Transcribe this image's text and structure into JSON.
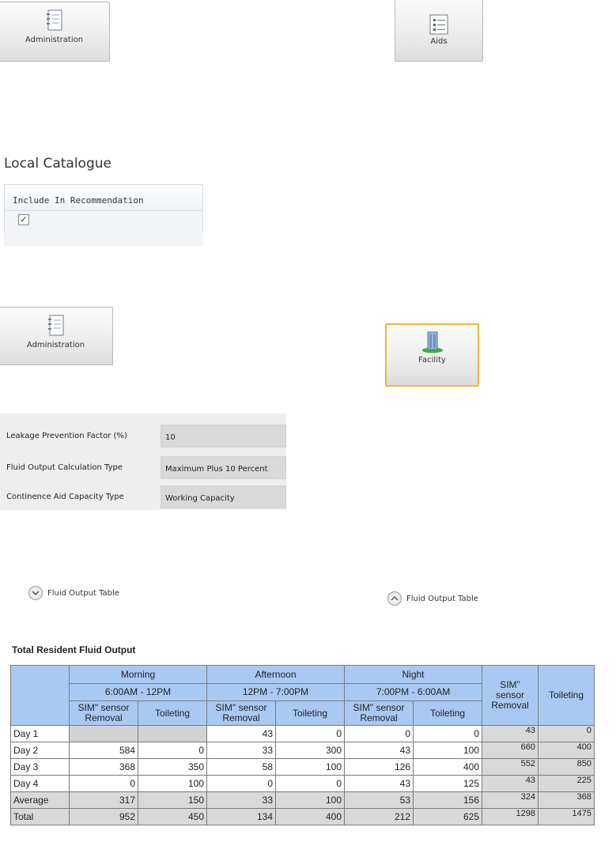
{
  "buttons": {
    "administration": "Administration",
    "aids": "Aids",
    "facility": "Facility"
  },
  "catalogue": {
    "title": "Local Catalogue",
    "column": "Include In Recommendation",
    "checked": "✓"
  },
  "settings": [
    {
      "label": "Leakage Prevention Factor (%)",
      "value": "10"
    },
    {
      "label": "Fluid Output Calculation Type",
      "value": "Maximum Plus 10 Percent"
    },
    {
      "label": "Continence Aid Capacity Type",
      "value": "Working Capacity"
    }
  ],
  "toggle": {
    "label": "Fluid Output Table"
  },
  "table": {
    "title": "Total Resident Fluid Output",
    "periods": [
      {
        "name": "Morning",
        "time": "6:00AM - 12PM"
      },
      {
        "name": "Afternoon",
        "time": "12PM - 7:00PM"
      },
      {
        "name": "Night",
        "time": "7:00PM - 6:00AM"
      }
    ],
    "sub_removal": "SIM\" sensor Removal",
    "sub_toileting": "Toileting",
    "rows": [
      {
        "label": "Day 1",
        "cells": [
          "",
          "",
          "43",
          "0",
          "0",
          "0"
        ],
        "sum": [
          "43",
          "0"
        ]
      },
      {
        "label": "Day 2",
        "cells": [
          "584",
          "0",
          "33",
          "300",
          "43",
          "100"
        ],
        "sum": [
          "660",
          "400"
        ]
      },
      {
        "label": "Day 3",
        "cells": [
          "368",
          "350",
          "58",
          "100",
          "126",
          "400"
        ],
        "sum": [
          "552",
          "850"
        ]
      },
      {
        "label": "Day 4",
        "cells": [
          "0",
          "100",
          "0",
          "0",
          "43",
          "125"
        ],
        "sum": [
          "43",
          "225"
        ]
      },
      {
        "label": "Average",
        "cells": [
          "317",
          "150",
          "33",
          "100",
          "53",
          "156"
        ],
        "sum": [
          "324",
          "368"
        ]
      },
      {
        "label": "Total",
        "cells": [
          "952",
          "450",
          "134",
          "400",
          "212",
          "625"
        ],
        "sum": [
          "1298",
          "1475"
        ]
      }
    ]
  }
}
